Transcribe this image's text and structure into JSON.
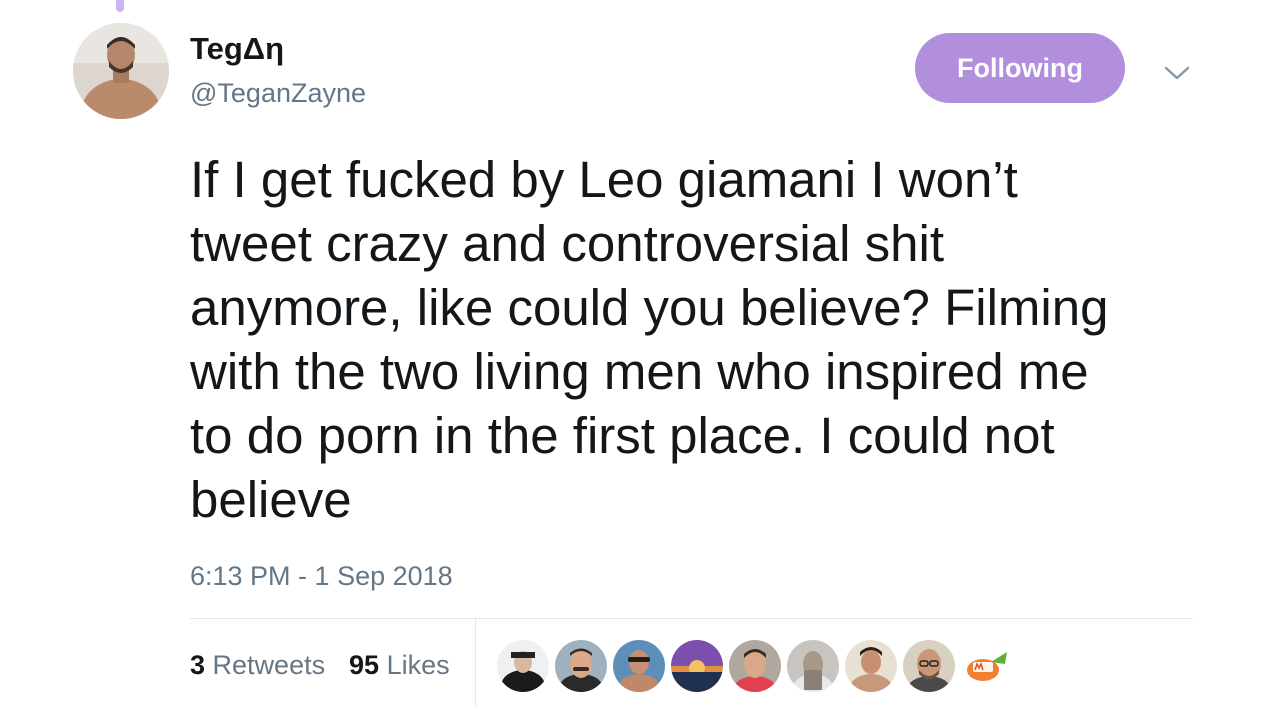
{
  "tweet": {
    "author": {
      "display_name": "TegΔη",
      "handle": "@TeganZayne"
    },
    "follow_button_label": "Following",
    "text_lines": [
      "If I get fucked by Leo giamani I won’t",
      "tweet crazy and controversial shit",
      "anymore, like could you believe? Filming",
      "with the two living men who inspired me",
      "to do porn in the first place. I could not",
      "believe"
    ],
    "timestamp": "6:13 PM - 1 Sep 2018",
    "stats": {
      "retweets_count": "3",
      "retweets_label": "Retweets",
      "likes_count": "95",
      "likes_label": "Likes"
    },
    "liker_avatars_count": 9
  },
  "colors": {
    "follow_button": "#b28fdd",
    "secondary_text": "#657786",
    "primary_text": "#14171a",
    "divider": "#e1e8ed",
    "thread_line": "#c9b6ee"
  },
  "icons": {
    "more": "chevron-down-icon"
  }
}
